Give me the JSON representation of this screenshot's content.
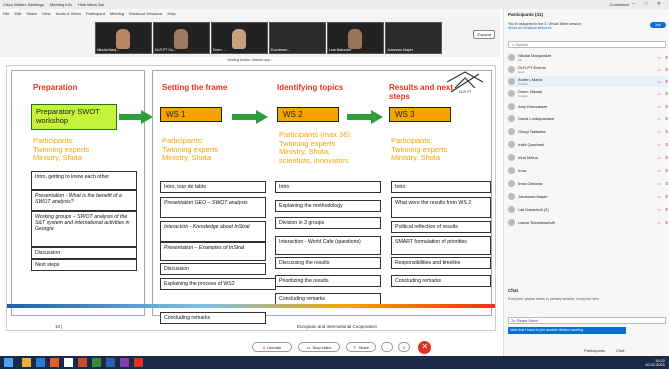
{
  "window": {
    "title_items": [
      "Cisco Webex Meetings",
      "Meeting Info",
      "Hide Menu Bar"
    ],
    "connected_label": "Connected",
    "window_controls": "– □ ✕"
  },
  "menu": [
    "File",
    "Edit",
    "Share",
    "View",
    "Audio & Video",
    "Participant",
    "Meeting",
    "Breakout Sessions",
    "Help"
  ],
  "video_strip": {
    "thumbs": [
      {
        "name": "Nikolai Manj...",
        "type": "face"
      },
      {
        "name": "DLR PT Gu...",
        "type": "face"
      },
      {
        "name": "Doerr, ...",
        "type": "face"
      },
      {
        "name": "Ecoviewer...",
        "type": "dark"
      },
      {
        "name": "Lela Bakradze",
        "type": "face"
      },
      {
        "name": "Johannes Mayer",
        "type": "dark"
      }
    ],
    "expand_label": "Expand"
  },
  "viewing_label": "Viewing Anden, Maria's app...",
  "slide": {
    "logo_text": "DLR PT",
    "columns": [
      {
        "title": "Preparation",
        "box": "Preparatory SWOT workshop",
        "participants": "Participants:\nTwinning experts\nMinistry, Shota",
        "items": [
          "Intro, getting to know each other",
          "Presentation - What is the benefit of a SWOT analysis?",
          "Working groups – SWOT analysis of the S&T system and international activities in Georgia",
          "Discussion",
          "Next steps"
        ]
      },
      {
        "title": "Setting the frame",
        "box": "WS 1",
        "participants": "Participants:\nTwinning experts\nMinistry, Shota",
        "items": [
          "Intro, tour de table",
          "Presentation GEO – SWOT analysis",
          "Interaction - Knowledge about InStrat",
          "Presentation – Examples of InStrat",
          "Discussion",
          "Explaining the process of WS2",
          "Concluding remarks"
        ]
      },
      {
        "title": "Identifying topics",
        "box": "WS 2",
        "participants": "Participants (max 36):\nTwinning experts\nMinistry, Shota,\nscientists, innovators",
        "items": [
          "Intro",
          "Explaining the methodology",
          "Division in 3 groups",
          "Interaction - World Cafe (questions)",
          "Discussing the results",
          "Prioritizing the results",
          "Concluding remarks"
        ]
      },
      {
        "title": "Results and next steps",
        "box": "WS 3",
        "participants": "Participants:\nTwinning experts\nMinistry, Shota",
        "items": [
          "Intro",
          "What were the results from WS 2",
          "Political reflection of results",
          "SMART formulation of priorities",
          "Responsibilities and timeline",
          "Concluding remarks"
        ]
      }
    ],
    "footer": "European and International Cooperation",
    "page_number": "10 |"
  },
  "toolbar": {
    "unmute": "Unmute",
    "stop_video": "Stop video",
    "share": "Share",
    "more": "..."
  },
  "panel": {
    "header": "Participants (31)",
    "note": "You're assigned to the 3. Virtual Table session.",
    "note2": "Show all breakout sessions",
    "join": "Join",
    "search_placeholder": "Search",
    "participants": [
      {
        "name": "Nikolai Manjavidze",
        "sub": "Me"
      },
      {
        "name": "DLR-PT Events",
        "sub": "Host"
      },
      {
        "name": "Anden, Maria",
        "sub": "Cohost"
      },
      {
        "name": "Doerr, Nikolai",
        "sub": "Cohost"
      },
      {
        "name": "Amy Khundadze",
        "sub": ""
      },
      {
        "name": "David Lordkipanidze",
        "sub": ""
      },
      {
        "name": "Giorgi Tsetskha",
        "sub": ""
      },
      {
        "name": "Irakli Qaurtami",
        "sub": ""
      },
      {
        "name": "Irina Melua",
        "sub": ""
      },
      {
        "name": "Irma",
        "sub": ""
      },
      {
        "name": "Irma Gabunia",
        "sub": ""
      },
      {
        "name": "Johannes Mayer",
        "sub": ""
      },
      {
        "name": "Lali Datashvili (3)",
        "sub": ""
      },
      {
        "name": "Lasha Tkeshelashvili",
        "sub": ""
      }
    ],
    "chat_header": "Chat",
    "chat_message": "Everyone: please return to plenary session, everyone here",
    "chat_to": "To: Please Select",
    "chat_selected": "Note that I have to join another Webex meeting",
    "bottom": [
      "Participants",
      "Chat"
    ]
  },
  "taskbar": {
    "time": "10:22",
    "date": "10.02.2021"
  }
}
